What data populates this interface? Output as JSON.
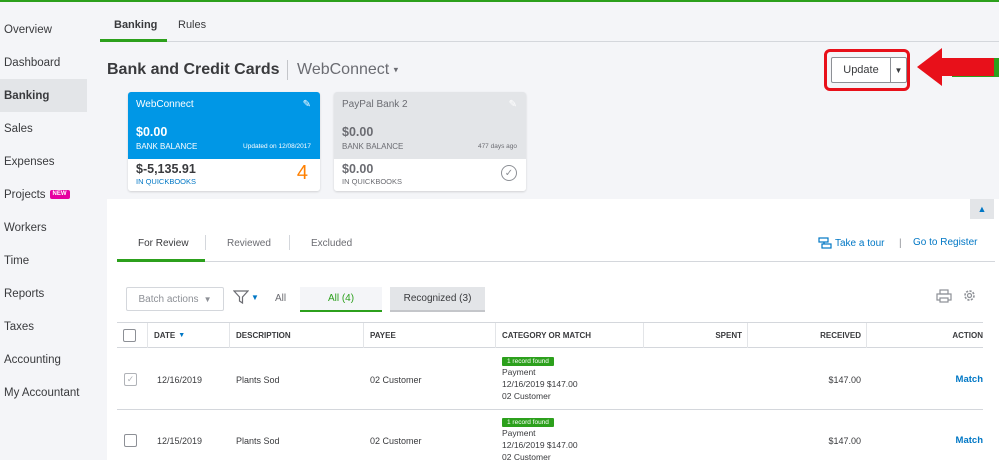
{
  "sidebar": {
    "items": [
      {
        "label": "Overview"
      },
      {
        "label": "Dashboard"
      },
      {
        "label": "Banking",
        "active": true
      },
      {
        "label": "Sales"
      },
      {
        "label": "Expenses"
      },
      {
        "label": "Projects",
        "badge": "NEW"
      },
      {
        "label": "Workers"
      },
      {
        "label": "Time"
      },
      {
        "label": "Reports"
      },
      {
        "label": "Taxes"
      },
      {
        "label": "Accounting"
      },
      {
        "label": "My Accountant"
      }
    ]
  },
  "top_tabs": [
    {
      "label": "Banking",
      "active": true
    },
    {
      "label": "Rules"
    }
  ],
  "header": {
    "title": "Bank and Credit Cards",
    "account": "WebConnect",
    "update_label": "Update"
  },
  "cards": [
    {
      "name": "WebConnect",
      "bank_balance": "$0.00",
      "bank_balance_label": "BANK BALANCE",
      "updated": "Updated on 12/08/2017",
      "qb_balance": "$-5,135.91",
      "qb_label": "IN QUICKBOOKS",
      "count": "4"
    },
    {
      "name": "PayPal Bank 2",
      "bank_balance": "$0.00",
      "bank_balance_label": "BANK BALANCE",
      "updated": "477 days ago",
      "qb_balance": "$0.00",
      "qb_label": "IN QUICKBOOKS"
    }
  ],
  "review": {
    "tabs": [
      "For Review",
      "Reviewed",
      "Excluded"
    ],
    "tour_link": "Take a tour",
    "register_link": "Go to Register",
    "batch_label": "Batch actions",
    "filter_all": "All",
    "pill_all": "All (4)",
    "pill_recognized": "Recognized (3)"
  },
  "table": {
    "columns": [
      "DATE",
      "DESCRIPTION",
      "PAYEE",
      "CATEGORY OR MATCH",
      "SPENT",
      "RECEIVED",
      "ACTION"
    ],
    "rows": [
      {
        "checked": true,
        "date": "12/16/2019",
        "description": "Plants Sod",
        "payee": "02 Customer",
        "badge": "1 record found",
        "cat1": "Payment",
        "cat2": "12/16/2019 $147.00",
        "cat3": "02 Customer",
        "spent": "",
        "received": "$147.00",
        "action": "Match"
      },
      {
        "checked": false,
        "date": "12/15/2019",
        "description": "Plants Sod",
        "payee": "02 Customer",
        "badge": "1 record found",
        "cat1": "Payment",
        "cat2": "12/16/2019 $147.00",
        "cat3": "02 Customer",
        "spent": "",
        "received": "$147.00",
        "action": "Match"
      }
    ]
  },
  "colors": {
    "brand_green": "#2ca01c",
    "card_blue": "#0097e6",
    "link_blue": "#0077c5",
    "highlight_red": "#e8101a",
    "count_orange": "#ff8000"
  }
}
